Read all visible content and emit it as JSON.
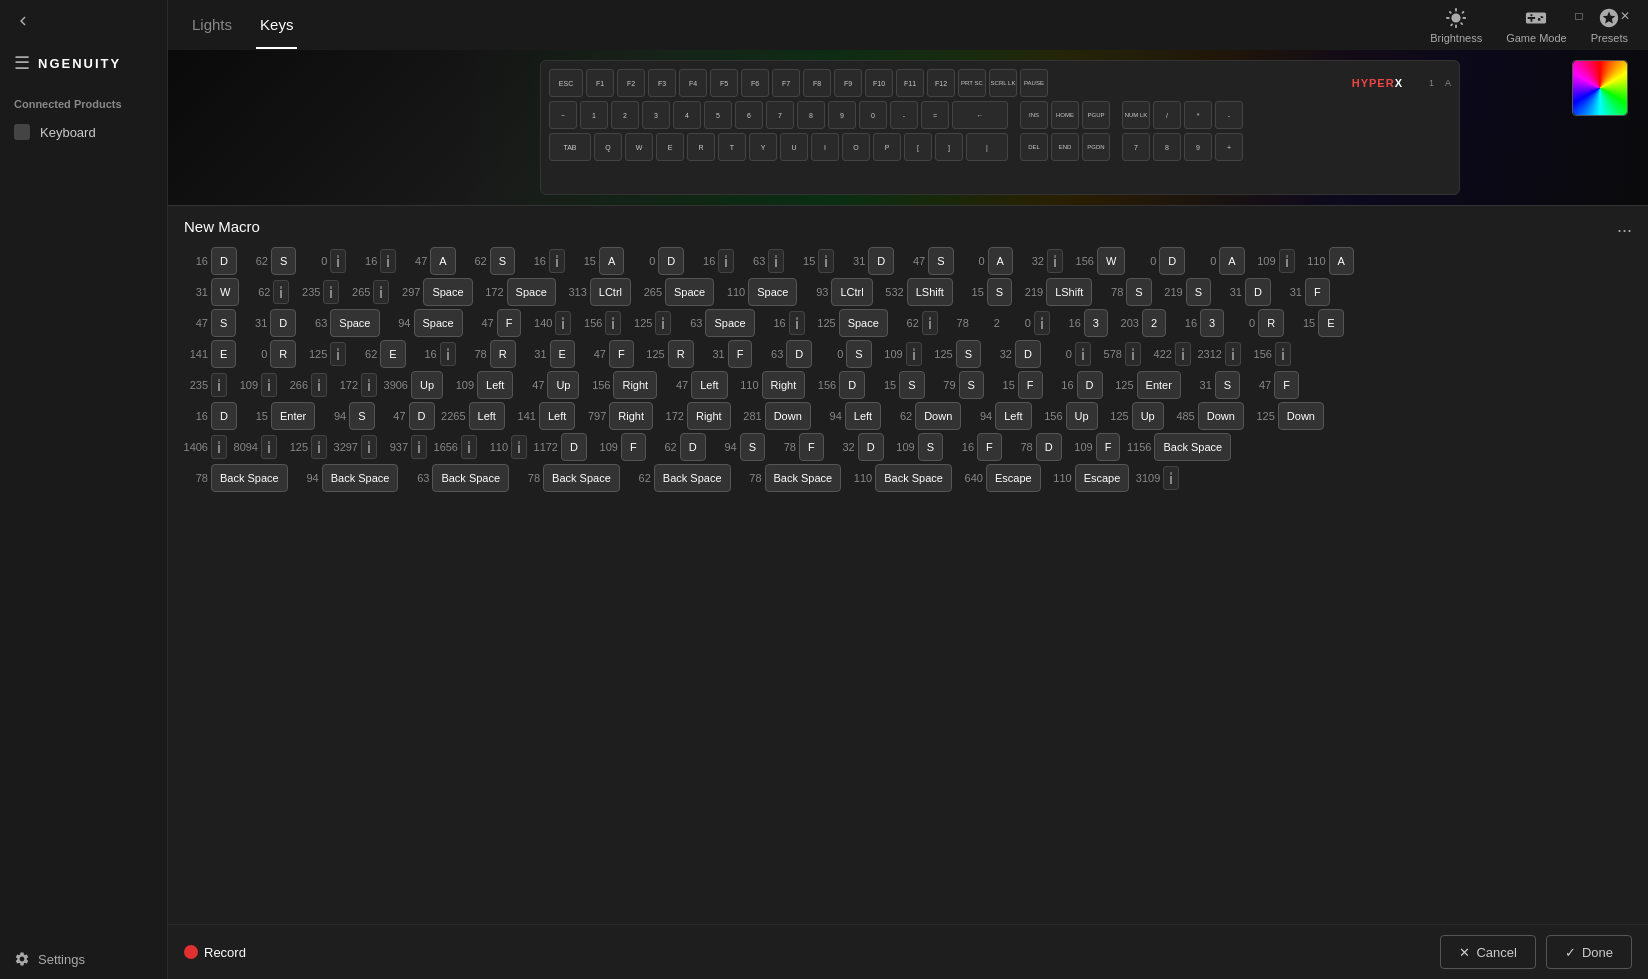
{
  "app": {
    "title": "NGENUITY"
  },
  "sidebar": {
    "back_label": "Back",
    "logo": "NGENUITY",
    "connected_products": "Connected Products",
    "keyboard_label": "Keyboard",
    "settings_label": "Settings"
  },
  "window_controls": {
    "minimize": "─",
    "maximize": "□",
    "close": "✕"
  },
  "topbar": {
    "tabs": [
      {
        "label": "Lights",
        "active": false
      },
      {
        "label": "Keys",
        "active": true
      }
    ],
    "controls": [
      {
        "label": "Brightness",
        "icon": "sun"
      },
      {
        "label": "Game Mode",
        "icon": "gamepad"
      },
      {
        "label": "Presets",
        "icon": "layers"
      }
    ]
  },
  "macro": {
    "title": "New Macro",
    "more_icon": "...",
    "rows": [
      [
        {
          "type": "num",
          "val": "16"
        },
        {
          "type": "key",
          "val": "D"
        },
        {
          "type": "num",
          "val": "62"
        },
        {
          "type": "key",
          "val": "S"
        },
        {
          "type": "num",
          "val": "0"
        },
        {
          "type": "delay"
        },
        {
          "type": "num",
          "val": "16"
        },
        {
          "type": "delay"
        },
        {
          "type": "num",
          "val": "47"
        },
        {
          "type": "key",
          "val": "A"
        },
        {
          "type": "num",
          "val": "62"
        },
        {
          "type": "key",
          "val": "S"
        },
        {
          "type": "num",
          "val": "16"
        },
        {
          "type": "delay"
        },
        {
          "type": "num",
          "val": "15"
        },
        {
          "type": "key",
          "val": "A"
        },
        {
          "type": "num",
          "val": "0"
        },
        {
          "type": "key",
          "val": "D"
        },
        {
          "type": "num",
          "val": "16"
        },
        {
          "type": "delay"
        },
        {
          "type": "num",
          "val": "63"
        },
        {
          "type": "delay"
        },
        {
          "type": "num",
          "val": "15"
        },
        {
          "type": "delay"
        },
        {
          "type": "num",
          "val": "31"
        },
        {
          "type": "key",
          "val": "D"
        },
        {
          "type": "num",
          "val": "47"
        },
        {
          "type": "key",
          "val": "S"
        },
        {
          "type": "num",
          "val": "0"
        },
        {
          "type": "key",
          "val": "A"
        },
        {
          "type": "num",
          "val": "32"
        },
        {
          "type": "delay"
        },
        {
          "type": "num",
          "val": "156"
        },
        {
          "type": "key",
          "val": "W"
        },
        {
          "type": "num",
          "val": "0"
        },
        {
          "type": "key",
          "val": "D"
        },
        {
          "type": "num",
          "val": "0"
        },
        {
          "type": "key",
          "val": "A"
        },
        {
          "type": "num",
          "val": "109"
        },
        {
          "type": "delay"
        },
        {
          "type": "num",
          "val": "110"
        },
        {
          "type": "key",
          "val": "A"
        }
      ],
      [
        {
          "type": "num",
          "val": "31"
        },
        {
          "type": "key",
          "val": "W"
        },
        {
          "type": "num",
          "val": "62"
        },
        {
          "type": "delay"
        },
        {
          "type": "num",
          "val": "235"
        },
        {
          "type": "delay"
        },
        {
          "type": "num",
          "val": "265"
        },
        {
          "type": "delay"
        },
        {
          "type": "num",
          "val": "297"
        },
        {
          "type": "key",
          "val": "Space"
        },
        {
          "type": "num",
          "val": "172"
        },
        {
          "type": "key",
          "val": "Space"
        },
        {
          "type": "num",
          "val": "313"
        },
        {
          "type": "key",
          "val": "LCtrl"
        },
        {
          "type": "num",
          "val": "265"
        },
        {
          "type": "key",
          "val": "Space"
        },
        {
          "type": "num",
          "val": "110"
        },
        {
          "type": "key",
          "val": "Space"
        },
        {
          "type": "num",
          "val": "93"
        },
        {
          "type": "key",
          "val": "LCtrl"
        },
        {
          "type": "num",
          "val": "532"
        },
        {
          "type": "key",
          "val": "LShift"
        },
        {
          "type": "num",
          "val": "15"
        },
        {
          "type": "key",
          "val": "S"
        },
        {
          "type": "num",
          "val": "219"
        },
        {
          "type": "key",
          "val": "LShift"
        },
        {
          "type": "num",
          "val": "78"
        },
        {
          "type": "key",
          "val": "S"
        },
        {
          "type": "num",
          "val": "219"
        },
        {
          "type": "key",
          "val": "S"
        },
        {
          "type": "num",
          "val": "31"
        },
        {
          "type": "key",
          "val": "D"
        },
        {
          "type": "num",
          "val": "31"
        },
        {
          "type": "key",
          "val": "F"
        }
      ],
      [
        {
          "type": "num",
          "val": "47"
        },
        {
          "type": "key",
          "val": "S"
        },
        {
          "type": "num",
          "val": "31"
        },
        {
          "type": "key",
          "val": "D"
        },
        {
          "type": "num",
          "val": "63"
        },
        {
          "type": "key",
          "val": "Space"
        },
        {
          "type": "num",
          "val": "94"
        },
        {
          "type": "key",
          "val": "Space"
        },
        {
          "type": "num",
          "val": "47"
        },
        {
          "type": "key",
          "val": "F"
        },
        {
          "type": "num",
          "val": "140"
        },
        {
          "type": "delay"
        },
        {
          "type": "num",
          "val": "156"
        },
        {
          "type": "delay"
        },
        {
          "type": "num",
          "val": "125"
        },
        {
          "type": "delay"
        },
        {
          "type": "num",
          "val": "63"
        },
        {
          "type": "key",
          "val": "Space"
        },
        {
          "type": "num",
          "val": "16"
        },
        {
          "type": "delay"
        },
        {
          "type": "num",
          "val": "125"
        },
        {
          "type": "key",
          "val": "Space"
        },
        {
          "type": "num",
          "val": "62"
        },
        {
          "type": "delay"
        },
        {
          "type": "num",
          "val": "78"
        },
        {
          "type": "num",
          "val": "2"
        },
        {
          "type": "num",
          "val": "0"
        },
        {
          "type": "delay"
        },
        {
          "type": "num",
          "val": "16"
        },
        {
          "type": "key",
          "val": "3"
        },
        {
          "type": "num",
          "val": "203"
        },
        {
          "type": "key",
          "val": "2"
        },
        {
          "type": "num",
          "val": "16"
        },
        {
          "type": "key",
          "val": "3"
        },
        {
          "type": "num",
          "val": "0"
        },
        {
          "type": "key",
          "val": "R"
        },
        {
          "type": "num",
          "val": "15"
        },
        {
          "type": "key",
          "val": "E"
        }
      ],
      [
        {
          "type": "num",
          "val": "141"
        },
        {
          "type": "key",
          "val": "E"
        },
        {
          "type": "num",
          "val": "0"
        },
        {
          "type": "key",
          "val": "R"
        },
        {
          "type": "num",
          "val": "125"
        },
        {
          "type": "delay"
        },
        {
          "type": "num",
          "val": "62"
        },
        {
          "type": "key",
          "val": "E"
        },
        {
          "type": "num",
          "val": "16"
        },
        {
          "type": "delay"
        },
        {
          "type": "num",
          "val": "78"
        },
        {
          "type": "key",
          "val": "R"
        },
        {
          "type": "num",
          "val": "31"
        },
        {
          "type": "key",
          "val": "E"
        },
        {
          "type": "num",
          "val": "47"
        },
        {
          "type": "key",
          "val": "F"
        },
        {
          "type": "num",
          "val": "125"
        },
        {
          "type": "key",
          "val": "R"
        },
        {
          "type": "num",
          "val": "31"
        },
        {
          "type": "key",
          "val": "F"
        },
        {
          "type": "num",
          "val": "63"
        },
        {
          "type": "key",
          "val": "D"
        },
        {
          "type": "num",
          "val": "0"
        },
        {
          "type": "key",
          "val": "S"
        },
        {
          "type": "num",
          "val": "109"
        },
        {
          "type": "delay"
        },
        {
          "type": "num",
          "val": "125"
        },
        {
          "type": "key",
          "val": "S"
        },
        {
          "type": "num",
          "val": "32"
        },
        {
          "type": "key",
          "val": "D"
        },
        {
          "type": "num",
          "val": "0"
        },
        {
          "type": "delay"
        },
        {
          "type": "num",
          "val": "578"
        },
        {
          "type": "delay"
        },
        {
          "type": "num",
          "val": "422"
        },
        {
          "type": "delay"
        },
        {
          "type": "num",
          "val": "2312"
        },
        {
          "type": "delay"
        },
        {
          "type": "num",
          "val": "156"
        },
        {
          "type": "delay"
        }
      ],
      [
        {
          "type": "num",
          "val": "235"
        },
        {
          "type": "delay"
        },
        {
          "type": "num",
          "val": "109"
        },
        {
          "type": "delay"
        },
        {
          "type": "num",
          "val": "266"
        },
        {
          "type": "delay"
        },
        {
          "type": "num",
          "val": "172"
        },
        {
          "type": "delay"
        },
        {
          "type": "num",
          "val": "3906"
        },
        {
          "type": "key",
          "val": "Up"
        },
        {
          "type": "num",
          "val": "109"
        },
        {
          "type": "key",
          "val": "Left"
        },
        {
          "type": "num",
          "val": "47"
        },
        {
          "type": "key",
          "val": "Up"
        },
        {
          "type": "num",
          "val": "156"
        },
        {
          "type": "key",
          "val": "Right"
        },
        {
          "type": "num",
          "val": "47"
        },
        {
          "type": "key",
          "val": "Left"
        },
        {
          "type": "num",
          "val": "110"
        },
        {
          "type": "key",
          "val": "Right"
        },
        {
          "type": "num",
          "val": "156"
        },
        {
          "type": "key",
          "val": "D"
        },
        {
          "type": "num",
          "val": "15"
        },
        {
          "type": "key",
          "val": "S"
        },
        {
          "type": "num",
          "val": "79"
        },
        {
          "type": "key",
          "val": "S"
        },
        {
          "type": "num",
          "val": "15"
        },
        {
          "type": "key",
          "val": "F"
        },
        {
          "type": "num",
          "val": "16"
        },
        {
          "type": "key",
          "val": "D"
        },
        {
          "type": "num",
          "val": "125"
        },
        {
          "type": "key",
          "val": "Enter"
        },
        {
          "type": "num",
          "val": "31"
        },
        {
          "type": "key",
          "val": "S"
        },
        {
          "type": "num",
          "val": "47"
        },
        {
          "type": "key",
          "val": "F"
        }
      ],
      [
        {
          "type": "num",
          "val": "16"
        },
        {
          "type": "key",
          "val": "D"
        },
        {
          "type": "num",
          "val": "15"
        },
        {
          "type": "key",
          "val": "Enter"
        },
        {
          "type": "num",
          "val": "94"
        },
        {
          "type": "key",
          "val": "S"
        },
        {
          "type": "num",
          "val": "47"
        },
        {
          "type": "key",
          "val": "D"
        },
        {
          "type": "num",
          "val": "2265"
        },
        {
          "type": "key",
          "val": "Left"
        },
        {
          "type": "num",
          "val": "141"
        },
        {
          "type": "key",
          "val": "Left"
        },
        {
          "type": "num",
          "val": "797"
        },
        {
          "type": "key",
          "val": "Right"
        },
        {
          "type": "num",
          "val": "172"
        },
        {
          "type": "key",
          "val": "Right"
        },
        {
          "type": "num",
          "val": "281"
        },
        {
          "type": "key",
          "val": "Down"
        },
        {
          "type": "num",
          "val": "94"
        },
        {
          "type": "key",
          "val": "Left"
        },
        {
          "type": "num",
          "val": "62"
        },
        {
          "type": "key",
          "val": "Down"
        },
        {
          "type": "num",
          "val": "94"
        },
        {
          "type": "key",
          "val": "Left"
        },
        {
          "type": "num",
          "val": "156"
        },
        {
          "type": "key",
          "val": "Up"
        },
        {
          "type": "num",
          "val": "125"
        },
        {
          "type": "key",
          "val": "Up"
        },
        {
          "type": "num",
          "val": "485"
        },
        {
          "type": "key",
          "val": "Down"
        },
        {
          "type": "num",
          "val": "125"
        },
        {
          "type": "key",
          "val": "Down"
        }
      ],
      [
        {
          "type": "num",
          "val": "1406"
        },
        {
          "type": "delay"
        },
        {
          "type": "num",
          "val": "8094"
        },
        {
          "type": "delay"
        },
        {
          "type": "num",
          "val": "125"
        },
        {
          "type": "delay"
        },
        {
          "type": "num",
          "val": "3297"
        },
        {
          "type": "delay"
        },
        {
          "type": "num",
          "val": "937"
        },
        {
          "type": "delay"
        },
        {
          "type": "num",
          "val": "1656"
        },
        {
          "type": "delay"
        },
        {
          "type": "num",
          "val": "110"
        },
        {
          "type": "delay"
        },
        {
          "type": "num",
          "val": "1172"
        },
        {
          "type": "key",
          "val": "D"
        },
        {
          "type": "num",
          "val": "109"
        },
        {
          "type": "key",
          "val": "F"
        },
        {
          "type": "num",
          "val": "62"
        },
        {
          "type": "key",
          "val": "D"
        },
        {
          "type": "num",
          "val": "94"
        },
        {
          "type": "key",
          "val": "S"
        },
        {
          "type": "num",
          "val": "78"
        },
        {
          "type": "key",
          "val": "F"
        },
        {
          "type": "num",
          "val": "32"
        },
        {
          "type": "key",
          "val": "D"
        },
        {
          "type": "num",
          "val": "109"
        },
        {
          "type": "key",
          "val": "S"
        },
        {
          "type": "num",
          "val": "16"
        },
        {
          "type": "key",
          "val": "F"
        },
        {
          "type": "num",
          "val": "78"
        },
        {
          "type": "key",
          "val": "D"
        },
        {
          "type": "num",
          "val": "109"
        },
        {
          "type": "key",
          "val": "F"
        },
        {
          "type": "num",
          "val": "1156"
        },
        {
          "type": "key",
          "val": "Back Space"
        }
      ],
      [
        {
          "type": "num",
          "val": "78"
        },
        {
          "type": "key",
          "val": "Back Space"
        },
        {
          "type": "num",
          "val": "94"
        },
        {
          "type": "key",
          "val": "Back Space"
        },
        {
          "type": "num",
          "val": "63"
        },
        {
          "type": "key",
          "val": "Back Space"
        },
        {
          "type": "num",
          "val": "78"
        },
        {
          "type": "key",
          "val": "Back Space"
        },
        {
          "type": "num",
          "val": "62"
        },
        {
          "type": "key",
          "val": "Back Space"
        },
        {
          "type": "num",
          "val": "78"
        },
        {
          "type": "key",
          "val": "Back Space"
        },
        {
          "type": "num",
          "val": "110"
        },
        {
          "type": "key",
          "val": "Back Space"
        },
        {
          "type": "num",
          "val": "640"
        },
        {
          "type": "key",
          "val": "Escape"
        },
        {
          "type": "num",
          "val": "110"
        },
        {
          "type": "key",
          "val": "Escape"
        },
        {
          "type": "num",
          "val": "3109"
        },
        {
          "type": "delay"
        }
      ]
    ],
    "record_label": "Record",
    "cancel_label": "Cancel",
    "done_label": "Done"
  }
}
